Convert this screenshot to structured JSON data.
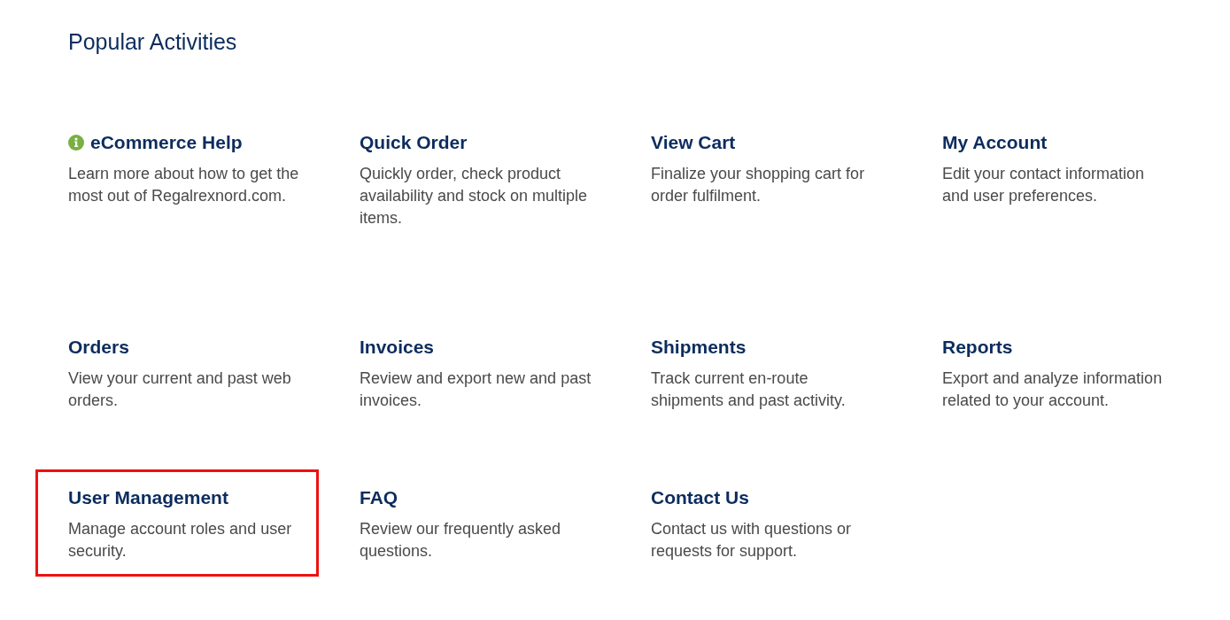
{
  "page": {
    "heading": "Popular Activities"
  },
  "activities": [
    {
      "kind": "info",
      "title": "eCommerce Help",
      "description": "Learn more about how to get the most out of Regalrexnord.com.",
      "highlighted": false
    },
    {
      "kind": "plain",
      "title": "Quick Order",
      "description": "Quickly order, check product availability and stock on multiple items.",
      "highlighted": false
    },
    {
      "kind": "plain",
      "title": "View Cart",
      "description": "Finalize your shopping cart for order fulfilment.",
      "highlighted": false
    },
    {
      "kind": "plain",
      "title": "My Account",
      "description": "Edit your contact information and user preferences.",
      "highlighted": false
    },
    {
      "kind": "plain",
      "title": "Orders",
      "description": "View your current and past web orders.",
      "highlighted": false
    },
    {
      "kind": "plain",
      "title": "Invoices",
      "description": "Review and export new and past invoices.",
      "highlighted": false
    },
    {
      "kind": "plain",
      "title": "Shipments",
      "description": "Track current en-route shipments and past activity.",
      "highlighted": false
    },
    {
      "kind": "plain",
      "title": "Reports",
      "description": "Export and analyze information related to your account.",
      "highlighted": false
    },
    {
      "kind": "plain",
      "title": "User Management",
      "description": "Manage account roles and user security.",
      "highlighted": true
    },
    {
      "kind": "plain",
      "title": "FAQ",
      "description": "Review our frequently asked questions.",
      "highlighted": false
    },
    {
      "kind": "plain",
      "title": "Contact Us",
      "description": "Contact us with questions or requests for support.",
      "highlighted": false
    }
  ]
}
